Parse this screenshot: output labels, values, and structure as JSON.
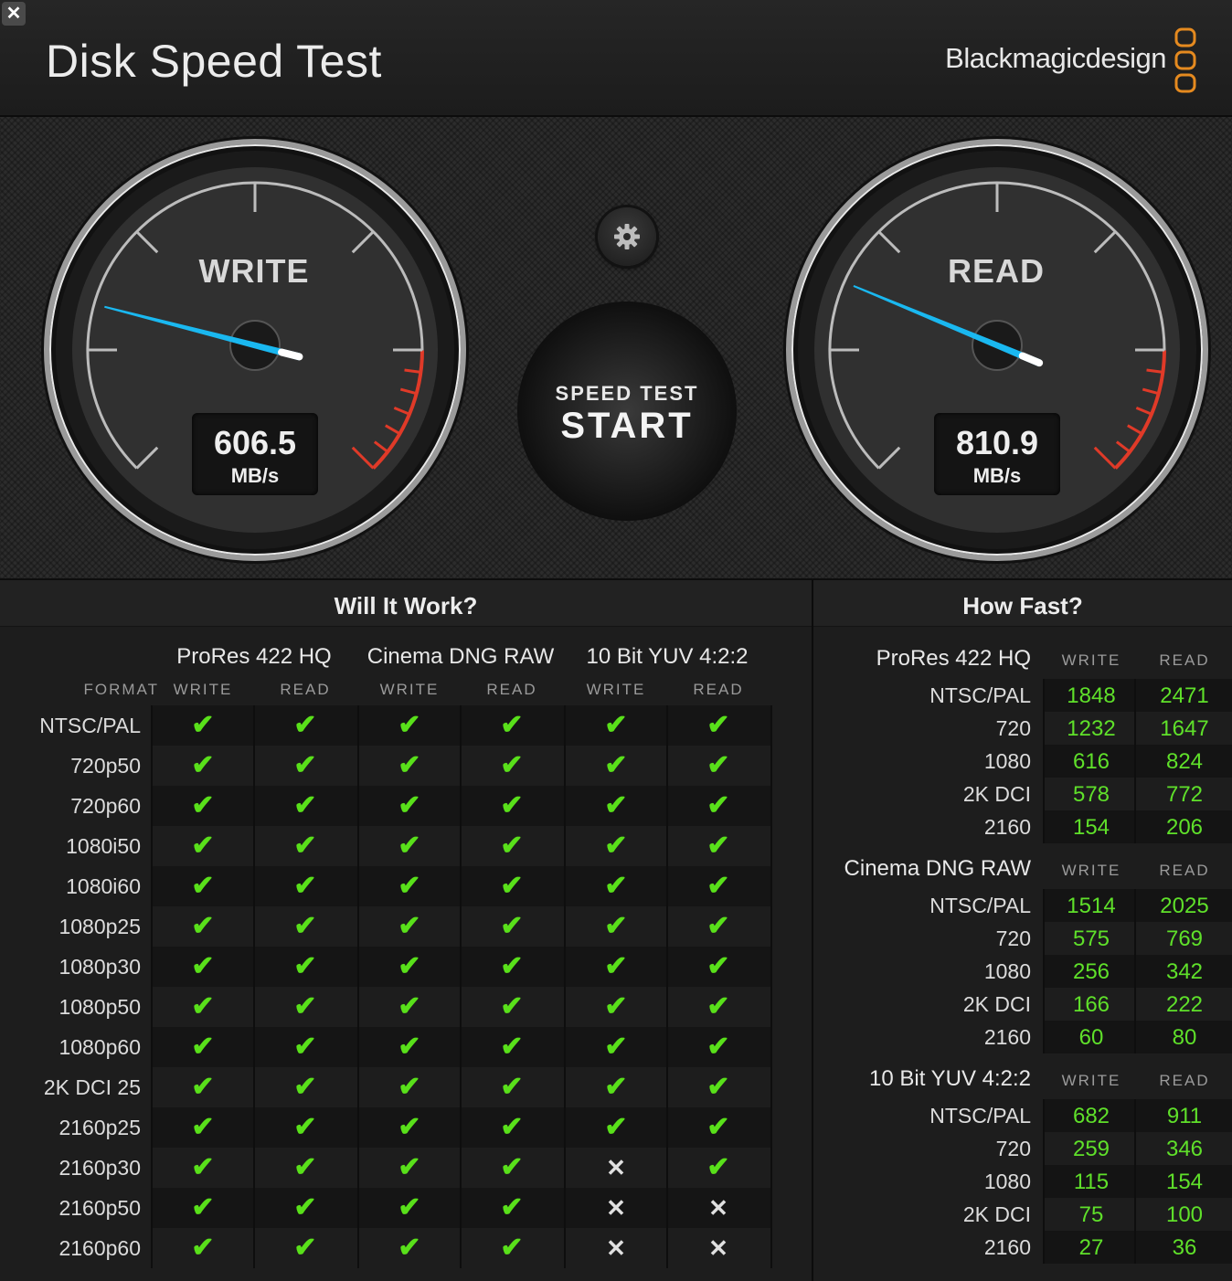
{
  "window": {
    "close_icon": "close-icon"
  },
  "header": {
    "title": "Disk Speed Test",
    "brand": "Blackmagicdesign"
  },
  "gauges": {
    "write": {
      "label": "WRITE",
      "value": "606.5",
      "unit": "MB/s",
      "needle_fraction": 0.22
    },
    "read": {
      "label": "READ",
      "value": "810.9",
      "unit": "MB/s",
      "needle_fraction": 0.25
    }
  },
  "start_button": {
    "top": "SPEED TEST",
    "main": "START"
  },
  "settings_icon": "gear-icon",
  "colors": {
    "check": "#59e01a",
    "needle": "#1ab8f0",
    "redline": "#e03a28",
    "logo": "#e58a1f",
    "speed": "#5fe02a"
  },
  "will_it_work": {
    "title": "Will It Work?",
    "format_header": "FORMAT",
    "groups": [
      "ProRes 422 HQ",
      "Cinema DNG RAW",
      "10 Bit YUV 4:2:2"
    ],
    "sub_columns": [
      "WRITE",
      "READ",
      "WRITE",
      "READ",
      "WRITE",
      "READ"
    ],
    "rows": [
      {
        "format": "NTSC/PAL",
        "cells": [
          1,
          1,
          1,
          1,
          1,
          1
        ]
      },
      {
        "format": "720p50",
        "cells": [
          1,
          1,
          1,
          1,
          1,
          1
        ]
      },
      {
        "format": "720p60",
        "cells": [
          1,
          1,
          1,
          1,
          1,
          1
        ]
      },
      {
        "format": "1080i50",
        "cells": [
          1,
          1,
          1,
          1,
          1,
          1
        ]
      },
      {
        "format": "1080i60",
        "cells": [
          1,
          1,
          1,
          1,
          1,
          1
        ]
      },
      {
        "format": "1080p25",
        "cells": [
          1,
          1,
          1,
          1,
          1,
          1
        ]
      },
      {
        "format": "1080p30",
        "cells": [
          1,
          1,
          1,
          1,
          1,
          1
        ]
      },
      {
        "format": "1080p50",
        "cells": [
          1,
          1,
          1,
          1,
          1,
          1
        ]
      },
      {
        "format": "1080p60",
        "cells": [
          1,
          1,
          1,
          1,
          1,
          1
        ]
      },
      {
        "format": "2K DCI 25",
        "cells": [
          1,
          1,
          1,
          1,
          1,
          1
        ]
      },
      {
        "format": "2160p25",
        "cells": [
          1,
          1,
          1,
          1,
          1,
          1
        ]
      },
      {
        "format": "2160p30",
        "cells": [
          1,
          1,
          1,
          1,
          0,
          1
        ]
      },
      {
        "format": "2160p50",
        "cells": [
          1,
          1,
          1,
          1,
          0,
          0
        ]
      },
      {
        "format": "2160p60",
        "cells": [
          1,
          1,
          1,
          1,
          0,
          0
        ]
      }
    ]
  },
  "how_fast": {
    "title": "How Fast?",
    "col_write": "WRITE",
    "col_read": "READ",
    "groups": [
      {
        "name": "ProRes 422 HQ",
        "rows": [
          {
            "label": "NTSC/PAL",
            "write": "1848",
            "read": "2471"
          },
          {
            "label": "720",
            "write": "1232",
            "read": "1647"
          },
          {
            "label": "1080",
            "write": "616",
            "read": "824"
          },
          {
            "label": "2K DCI",
            "write": "578",
            "read": "772"
          },
          {
            "label": "2160",
            "write": "154",
            "read": "206"
          }
        ]
      },
      {
        "name": "Cinema DNG RAW",
        "rows": [
          {
            "label": "NTSC/PAL",
            "write": "1514",
            "read": "2025"
          },
          {
            "label": "720",
            "write": "575",
            "read": "769"
          },
          {
            "label": "1080",
            "write": "256",
            "read": "342"
          },
          {
            "label": "2K DCI",
            "write": "166",
            "read": "222"
          },
          {
            "label": "2160",
            "write": "60",
            "read": "80"
          }
        ]
      },
      {
        "name": "10 Bit YUV 4:2:2",
        "rows": [
          {
            "label": "NTSC/PAL",
            "write": "682",
            "read": "911"
          },
          {
            "label": "720",
            "write": "259",
            "read": "346"
          },
          {
            "label": "1080",
            "write": "115",
            "read": "154"
          },
          {
            "label": "2K DCI",
            "write": "75",
            "read": "100"
          },
          {
            "label": "2160",
            "write": "27",
            "read": "36"
          }
        ]
      }
    ]
  }
}
